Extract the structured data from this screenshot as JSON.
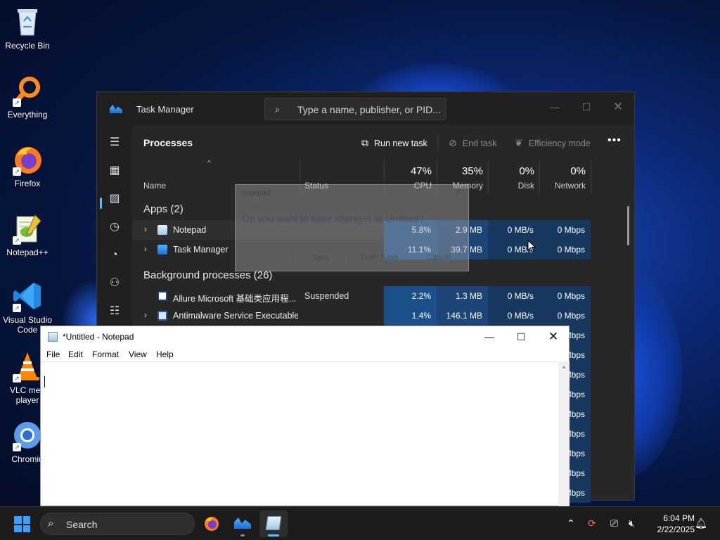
{
  "desktop": {
    "icons": [
      {
        "label": "Recycle Bin"
      },
      {
        "label": "Everything"
      },
      {
        "label": "Firefox"
      },
      {
        "label": "Notepad++"
      },
      {
        "label": "Visual Studio Code"
      },
      {
        "label": "VLC media player",
        "visible_label": "VLC med player"
      },
      {
        "label": "Chromium",
        "visible_label": "Chromiu"
      }
    ]
  },
  "task_manager": {
    "title": "Task Manager",
    "search_placeholder": "Type a name, publisher, or PID...",
    "page_title": "Processes",
    "toolbar": {
      "run_new_task": "Run new task",
      "end_task": "End task",
      "efficiency_mode": "Efficiency mode",
      "more": "•••"
    },
    "columns": {
      "name": "Name",
      "status": "Status",
      "cpu_pct": "47%",
      "cpu": "CPU",
      "memory_pct": "35%",
      "memory": "Memory",
      "disk_pct": "0%",
      "disk": "Disk",
      "network_pct": "0%",
      "network": "Network"
    },
    "apps_group": "Apps (2)",
    "background_group": "Background processes (26)",
    "apps": [
      {
        "name": "Notepad",
        "status": "",
        "cpu": "5.8%",
        "memory": "2.9 MB",
        "disk": "0 MB/s",
        "network": "0 Mbps"
      },
      {
        "name": "Task Manager",
        "status": "",
        "cpu": "11.1%",
        "memory": "39.7 MB",
        "disk": "0 MB/s",
        "network": "0 Mbps"
      }
    ],
    "background": [
      {
        "name": "Allure Microsoft 基础类应用程...",
        "status": "Suspended",
        "cpu": "2.2%",
        "memory": "1.3 MB",
        "disk": "0 MB/s",
        "network": "0 Mbps"
      },
      {
        "name": "Antimalware Service Executable",
        "status": "",
        "cpu": "1.4%",
        "memory": "146.1 MB",
        "disk": "0 MB/s",
        "network": "0 Mbps"
      }
    ],
    "partial_network_rows": [
      "Mbps",
      "Mbps",
      "Mbps",
      "Mbps",
      "Mbps",
      "Mbps",
      "Mbps",
      "Mbps",
      "Mbps"
    ]
  },
  "save_dialog_ghost": {
    "title": "Notepad",
    "message": "Do you want to save changes to Untitled?",
    "save": "Save",
    "dont_save": "Don't Save",
    "cancel": "Cancel"
  },
  "notepad": {
    "title": "*Untitled - Notepad",
    "menu": {
      "file": "File",
      "edit": "Edit",
      "format": "Format",
      "view": "View",
      "help": "Help"
    },
    "content": ""
  },
  "taskbar": {
    "search_label": "Search",
    "time": "6:04 PM",
    "date": "2/22/2025"
  },
  "colors": {
    "accent": "#4cc2ff",
    "tm_bg": "#202020",
    "cpu_heat": "#1b4f8a",
    "mem_heat": "#1d4577",
    "low_heat": "#17385f"
  }
}
